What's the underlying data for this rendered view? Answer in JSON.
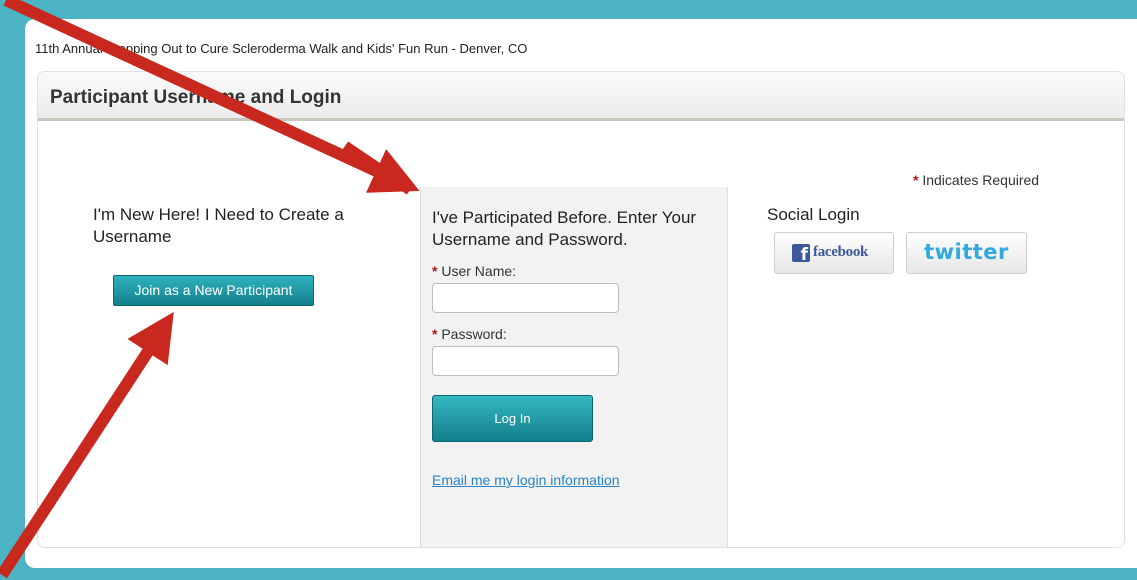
{
  "event": {
    "title": "11th Annual Stepping Out to Cure Scleroderma Walk and Kids' Fun Run - Denver, CO"
  },
  "panel": {
    "title": "Participant Username and Login"
  },
  "required_note": {
    "star": "*",
    "text": "Indicates Required"
  },
  "new_participant": {
    "heading": "I'm New Here! I Need to Create a Username",
    "button_label": "Join as a New Participant"
  },
  "login": {
    "heading": "I've Participated Before. Enter Your Username and Password.",
    "username_label": "User Name:",
    "username_value": "",
    "password_label": "Password:",
    "password_value": "",
    "required_star": "*",
    "button_label": "Log In",
    "email_link": "Email me my login information"
  },
  "social": {
    "heading": "Social Login",
    "facebook_label": "facebook",
    "facebook_logo": "f",
    "twitter_label": "twitter"
  },
  "colors": {
    "frame": "#4bb3c3",
    "button_teal": "#1b96a3",
    "required_red": "#b3141b",
    "annotation_arrow": "#c8281e",
    "link_blue": "#2a84c9",
    "facebook_blue": "#3b5998",
    "twitter_blue": "#2fa9df"
  },
  "annotations": {
    "arrow_count": 3
  }
}
